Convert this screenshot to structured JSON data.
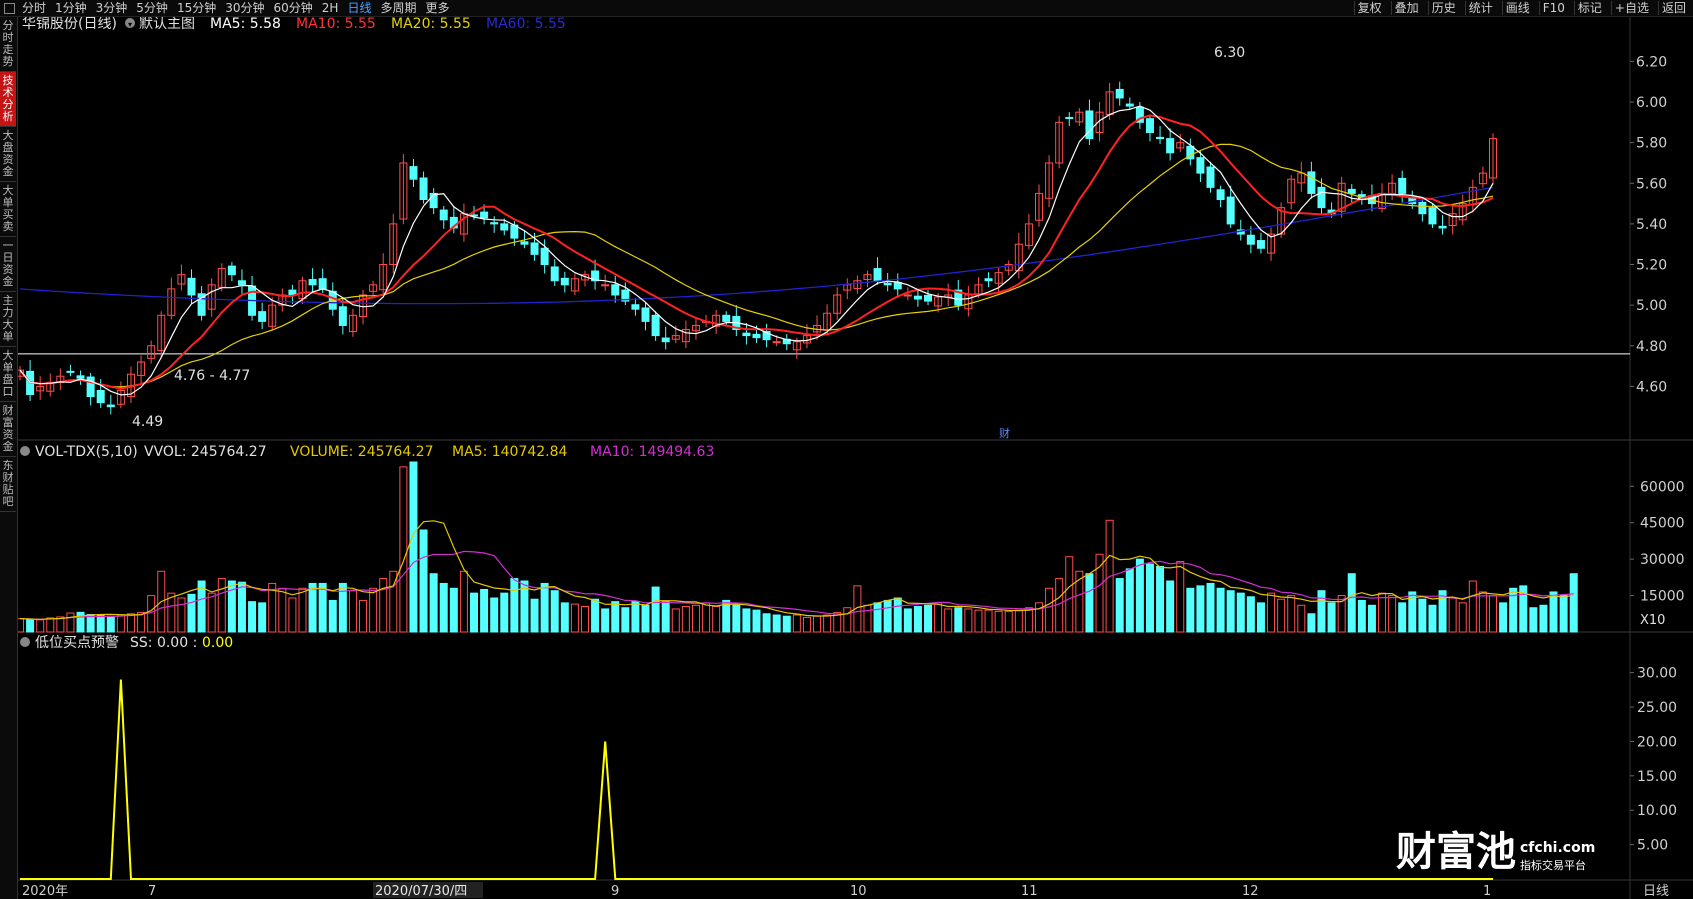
{
  "toolbar": {
    "periods": [
      "分时",
      "1分钟",
      "3分钟",
      "5分钟",
      "15分钟",
      "30分钟",
      "60分钟",
      "2H",
      "日线",
      "多周期",
      "更多"
    ],
    "active_period": "日线",
    "tools": [
      "复权",
      "叠加",
      "历史",
      "统计",
      "画线",
      "F10",
      "标记",
      "+自选",
      "返回"
    ]
  },
  "left_tabs": [
    "分时走势",
    "技术分析",
    "大盘资金",
    "大单买卖",
    "一日资金",
    "主力大单",
    "大单盘口",
    "财富资金",
    "东财贴吧"
  ],
  "active_left_tab": "技术分析",
  "main_header": {
    "stock_name": "华锦股份(日线)",
    "template": "默认主图",
    "ma5": "MA5: 5.58",
    "ma10": "MA10: 5.55",
    "ma20": "MA20: 5.55",
    "ma60": "MA60: 5.55"
  },
  "volume_header": {
    "title": "VOL-TDX(5,10)",
    "vvol": "VVOL: 245764.27",
    "volume": "VOLUME: 245764.27",
    "ma5": "MA5: 140742.84",
    "ma10": "MA10: 149494.63"
  },
  "indicator_header": {
    "title": "低位买点预警",
    "ss": "SS: 0.00 :",
    "value": "0.00"
  },
  "annotations": {
    "high": "6.30",
    "low": "4.49",
    "range": "4.76 - 4.77",
    "event": "财"
  },
  "x_axis": {
    "labels": [
      "2020年",
      "7",
      "2020/07/30/四",
      "9",
      "10",
      "11",
      "12",
      "1"
    ],
    "corner_label": "日线"
  },
  "volume_unit": "X10",
  "colors": {
    "up": "#ff4d4d",
    "down": "#54ffff",
    "ma5": "#ffffff",
    "ma10": "#ff2222",
    "ma20": "#e6d200",
    "ma60": "#2222cc",
    "vol_ma5": "#e6c800",
    "vol_ma10": "#d030d0",
    "indicator": "#ffff00"
  },
  "watermark": {
    "brand": "财富池",
    "site": "cfchi.com",
    "tagline": "指标交易平台"
  },
  "chart_data": [
    {
      "type": "candlestick",
      "title": "华锦股份(日线)",
      "y_ticks": [
        "6.20",
        "6.00",
        "5.80",
        "5.60",
        "5.40",
        "5.20",
        "5.00",
        "4.80",
        "4.60"
      ],
      "ylim": [
        4.4,
        6.33
      ],
      "close": [
        4.68,
        4.56,
        4.6,
        4.62,
        4.65,
        4.67,
        4.64,
        4.55,
        4.52,
        4.5,
        4.58,
        4.66,
        4.72,
        4.8,
        4.95,
        5.08,
        5.15,
        5.05,
        4.95,
        5.1,
        5.18,
        5.15,
        5.1,
        4.95,
        4.92,
        5.0,
        5.05,
        5.05,
        5.12,
        5.1,
        5.08,
        4.98,
        4.9,
        4.95,
        5.05,
        5.1,
        5.2,
        5.4,
        5.7,
        5.62,
        5.52,
        5.48,
        5.42,
        5.38,
        5.45,
        5.44,
        5.43,
        5.4,
        5.37,
        5.33,
        5.3,
        5.25,
        5.2,
        5.12,
        5.1,
        5.13,
        5.15,
        5.12,
        5.1,
        5.05,
        5.02,
        4.98,
        4.92,
        4.85,
        4.82,
        4.85,
        4.88,
        4.9,
        4.92,
        4.95,
        4.92,
        4.88,
        4.85,
        4.84,
        4.83,
        4.82,
        4.81,
        4.82,
        4.85,
        4.9,
        4.96,
        5.05,
        5.1,
        5.12,
        5.15,
        5.12,
        5.1,
        5.08,
        5.05,
        5.03,
        5.02,
        5.04,
        5.05,
        5.0,
        5.05,
        5.1,
        5.12,
        5.16,
        5.2,
        5.3,
        5.4,
        5.55,
        5.7,
        5.9,
        5.92,
        5.95,
        5.82,
        5.95,
        6.05,
        6.02,
        5.98,
        5.9,
        5.85,
        5.82,
        5.75,
        5.8,
        5.72,
        5.65,
        5.58,
        5.52,
        5.4,
        5.35,
        5.3,
        5.28,
        5.35,
        5.48,
        5.62,
        5.65,
        5.55,
        5.48,
        5.45,
        5.6,
        5.55,
        5.52,
        5.5,
        5.55,
        5.6,
        5.55,
        5.5,
        5.45,
        5.4,
        5.38,
        5.45,
        5.5,
        5.58,
        5.65,
        5.82
      ],
      "ma60_start": 5.08,
      "ma60_end": 5.55
    },
    {
      "type": "bar",
      "title": "VOL-TDX(5,10)",
      "unit": "X10",
      "y_ticks": [
        "60000",
        "45000",
        "30000",
        "15000"
      ],
      "ylim": [
        0,
        70000
      ],
      "values": [
        5500,
        5200,
        5000,
        5800,
        6200,
        7800,
        8100,
        7200,
        6800,
        6500,
        7000,
        7500,
        8000,
        15000,
        25000,
        16000,
        14000,
        15500,
        21000,
        16000,
        22000,
        21000,
        20500,
        12500,
        12000,
        20000,
        18000,
        14000,
        18000,
        20000,
        20000,
        13000,
        20000,
        17000,
        13000,
        18000,
        22000,
        25000,
        68000,
        70000,
        42000,
        24000,
        20000,
        18000,
        25000,
        16000,
        17500,
        14000,
        16000,
        22000,
        21000,
        13500,
        20000,
        17000,
        12000,
        11500,
        10500,
        13500,
        9500,
        12500,
        10000,
        12500,
        11000,
        18500,
        12500,
        9500,
        10500,
        11000,
        12000,
        10500,
        13000,
        11000,
        9500,
        9000,
        7500,
        7000,
        6500,
        7000,
        6000,
        6500,
        7000,
        8000,
        10000,
        19000,
        11000,
        12000,
        13000,
        14000,
        9500,
        10500,
        11000,
        12000,
        9500,
        10000,
        9500,
        9000,
        9000,
        8500,
        8500,
        9000,
        10000,
        12000,
        18000,
        22000,
        31000,
        25000,
        24000,
        32000,
        46000,
        22000,
        26000,
        30000,
        28000,
        27000,
        21000,
        29000,
        18000,
        19000,
        20000,
        18000,
        17000,
        16000,
        14500,
        12000,
        16000,
        13500,
        15000,
        11000,
        7500,
        17000,
        12000,
        15000,
        24000,
        13000,
        11000,
        16000,
        15000,
        12000,
        16500,
        13500,
        11000,
        17000,
        14000,
        12000,
        21000,
        16500,
        15000,
        12000,
        18000,
        19000,
        10000,
        11000,
        16500,
        15000,
        24000
      ]
    },
    {
      "type": "line",
      "title": "低位买点预警",
      "y_ticks": [
        "30.00",
        "25.00",
        "20.00",
        "15.00",
        "10.00",
        "5.00"
      ],
      "ylim": [
        0,
        33
      ],
      "series": [
        {
          "name": "SS",
          "spikes": [
            {
              "index": 10,
              "value": 29.0
            },
            {
              "index": 58,
              "value": 20.0
            }
          ]
        }
      ]
    }
  ]
}
